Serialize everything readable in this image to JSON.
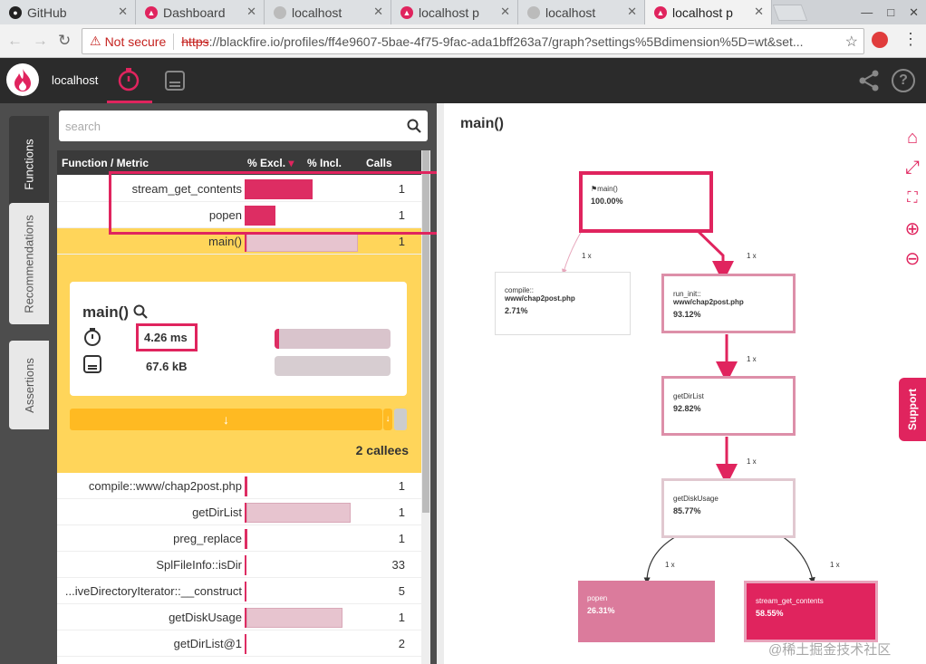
{
  "browser": {
    "tabs": [
      {
        "title": "GitHub"
      },
      {
        "title": "Dashboard"
      },
      {
        "title": "localhost"
      },
      {
        "title": "localhost p"
      },
      {
        "title": "localhost"
      },
      {
        "title": "localhost p"
      }
    ],
    "security_label": "Not secure",
    "url_scheme": "https",
    "url_rest": "://blackfire.io/profiles/ff4e9607-5bae-4f75-9fac-ada1bff263a7/graph?settings%5Bdimension%5D=wt&set..."
  },
  "app": {
    "host": "localhost"
  },
  "sidebar": {
    "tabs": [
      "Functions",
      "Recommendations",
      "Assertions"
    ]
  },
  "search": {
    "placeholder": "search"
  },
  "table": {
    "headers": {
      "function": "Function / Metric",
      "excl": "% Excl.",
      "incl": "% Incl.",
      "calls": "Calls"
    },
    "top_rows": [
      {
        "name": "stream_get_contents",
        "excl_pct": 58.55,
        "calls": "1"
      },
      {
        "name": "popen",
        "excl_pct": 26.31,
        "calls": "1"
      },
      {
        "name": "main()",
        "excl_pct": 0.0,
        "incl_pct": 100,
        "calls": "1"
      }
    ],
    "detail": {
      "title": "main()",
      "time": "4.26 ms",
      "memory": "67.6 kB",
      "arrow": "↓",
      "arrow_small": "↓",
      "callees": "2 callees"
    },
    "bottom_rows": [
      {
        "name": "compile::www/chap2post.php",
        "calls": "1"
      },
      {
        "name": "getDirList",
        "calls": "1"
      },
      {
        "name": "preg_replace",
        "calls": "1"
      },
      {
        "name": "SplFileInfo::isDir",
        "calls": "33"
      },
      {
        "name": "...iveDirectoryIterator::__construct",
        "calls": "5"
      },
      {
        "name": "getDiskUsage",
        "calls": "1"
      },
      {
        "name": "getDirList@1",
        "calls": "2"
      }
    ]
  },
  "graph": {
    "title": "main()",
    "nodes": {
      "main": {
        "name": "main()",
        "pct": "100.00%"
      },
      "compile": {
        "line1": "compile::",
        "line2": "www/chap2post.php",
        "pct": "2.71%"
      },
      "run_init": {
        "line1": "run_init::",
        "line2": "www/chap2post.php",
        "pct": "93.12%"
      },
      "getdirlist": {
        "name": "getDirList",
        "pct": "92.82%"
      },
      "getdiskusage": {
        "name": "getDiskUsage",
        "pct": "85.77%"
      },
      "popen": {
        "name": "popen",
        "pct": "26.31%"
      },
      "stream": {
        "name": "stream_get_contents",
        "pct": "58.55%"
      }
    },
    "edge_label": "1 x"
  },
  "support_label": "Support",
  "watermark": "@稀土掘金技术社区",
  "colors": {
    "accent": "#e0245e",
    "highlight": "#ffd55a",
    "dark": "#2b2b2b"
  }
}
